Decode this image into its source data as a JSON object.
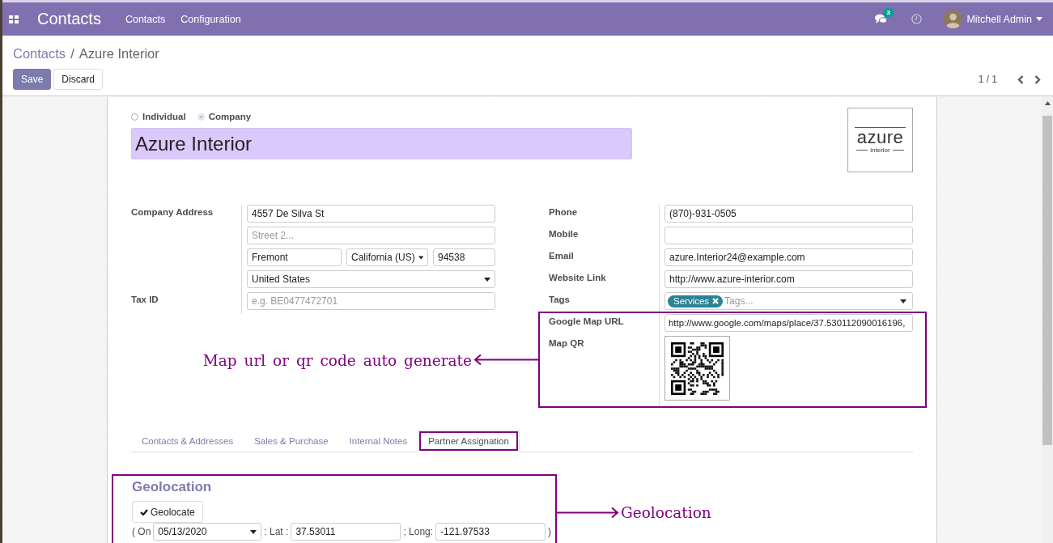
{
  "navbar": {
    "app_name": "Contacts",
    "menus": [
      "Contacts",
      "Configuration"
    ],
    "messages_badge": "3",
    "user_name": "Mitchell Admin"
  },
  "breadcrumb": {
    "items": [
      {
        "label": "Contacts",
        "kind": "link"
      },
      {
        "label": "Azure Interior",
        "kind": "current"
      }
    ],
    "separator": "/"
  },
  "buttons": [
    {
      "label": "Save",
      "kind": "primary"
    },
    {
      "label": "Discard",
      "kind": "secondary"
    }
  ],
  "pager": "1 / 1",
  "company_type": [
    {
      "label": "Individual",
      "selected": false
    },
    {
      "label": "Company",
      "selected": true
    }
  ],
  "name": "Azure Interior",
  "logo": {
    "word": "azure",
    "subtitle": "interior"
  },
  "address": {
    "label": "Company Address",
    "street": "4557 De Silva St",
    "street2_placeholder": "Street 2...",
    "city": "Fremont",
    "state": "California (US)",
    "zip": "94538",
    "country": "United States"
  },
  "tax_id": {
    "label": "Tax ID",
    "placeholder": "e.g. BE0477472701"
  },
  "right_fields": [
    {
      "label": "Phone",
      "kind": "text",
      "value": "(870)-931-0505",
      "annotated": false
    },
    {
      "label": "Mobile",
      "kind": "text",
      "annotated": false
    },
    {
      "label": "Email",
      "kind": "text",
      "value": "azure.Interior24@example.com",
      "annotated": false
    },
    {
      "label": "Website Link",
      "kind": "text",
      "value": "http://www.azure-interior.com",
      "annotated": false
    },
    {
      "label": "Tags",
      "kind": "tags",
      "tags": [
        "Services"
      ],
      "placeholder": "Tags...",
      "annotated": false
    },
    {
      "label": "Google Map URL",
      "kind": "text",
      "value": "http://www.google.com/maps/place/37.530112090016196,",
      "annotated": true
    },
    {
      "label": "Map QR",
      "kind": "qr",
      "annotated": true
    }
  ],
  "map_callout": "Map url or qr code auto generate",
  "tabs": [
    {
      "label": "Contacts & Addresses",
      "selected": false,
      "annotated": false
    },
    {
      "label": "Sales & Purchase",
      "selected": false,
      "annotated": false
    },
    {
      "label": "Internal Notes",
      "selected": false,
      "annotated": false
    },
    {
      "label": "Partner Assignation",
      "selected": true,
      "annotated": true
    }
  ],
  "geolocation": {
    "title": "Geolocation",
    "button": "Geolocate",
    "open_text": "( On",
    "date": "05/13/2020",
    "lat_label": ": Lat :",
    "lat": "37.53011",
    "long_label": "; Long:",
    "long": "-121.97533",
    "close_text": ")",
    "annotated": true,
    "callout": "Geolocation"
  }
}
